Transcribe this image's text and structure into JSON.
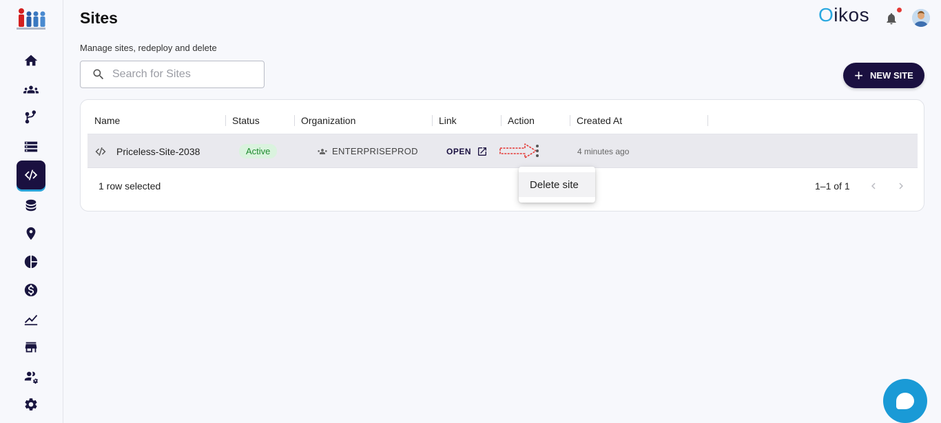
{
  "header": {
    "title": "Sites",
    "subtitle": "Manage sites, redeploy and delete",
    "brand_first": "O",
    "brand_rest": "ikos"
  },
  "search": {
    "placeholder": "Search for Sites",
    "value": ""
  },
  "new_site_button": {
    "label": "NEW SITE"
  },
  "sidebar": {
    "items": [
      {
        "icon": "home-icon"
      },
      {
        "icon": "groups-icon"
      },
      {
        "icon": "branch-icon"
      },
      {
        "icon": "servers-icon"
      },
      {
        "icon": "code-icon",
        "active": true
      },
      {
        "icon": "database-icon"
      },
      {
        "icon": "location-pin-icon"
      },
      {
        "icon": "pie-chart-icon"
      },
      {
        "icon": "dollar-icon"
      },
      {
        "icon": "trending-icon"
      },
      {
        "icon": "store-icon"
      },
      {
        "icon": "users-settings-icon"
      },
      {
        "icon": "settings-icon"
      }
    ]
  },
  "table": {
    "columns": [
      "Name",
      "Status",
      "Organization",
      "Link",
      "Action",
      "Created At"
    ],
    "rows": [
      {
        "name": "Priceless-Site-2038",
        "status": "Active",
        "organization": "ENTERPRISEPROD",
        "link": "OPEN",
        "created_at": "4 minutes ago"
      }
    ],
    "selected_text": "1 row selected",
    "pagination": "1–1 of 1"
  },
  "context_menu": {
    "items": [
      "Delete site"
    ]
  },
  "colors": {
    "primary": "#1a1040",
    "accent": "#29a8e0",
    "status_active_bg": "#daf3de",
    "status_active_text": "#1e8b2e",
    "notification_dot": "#e53935",
    "chat_button": "#1a9ad6"
  }
}
